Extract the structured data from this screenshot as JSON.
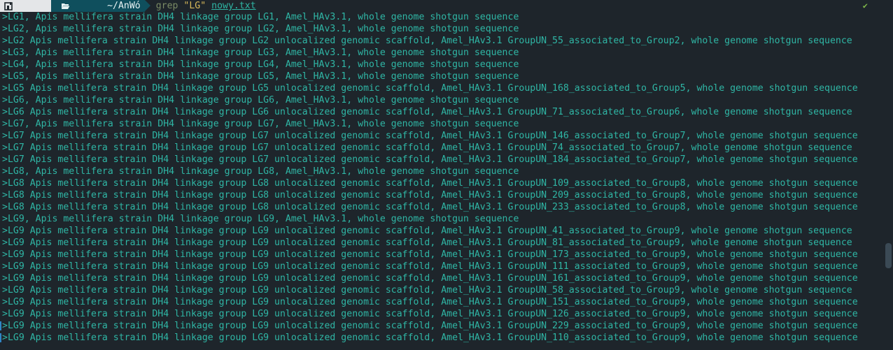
{
  "prompt": {
    "home_icon": "home-icon",
    "folder_icon": "folder-open-icon",
    "directory": "~/AnWó",
    "command": "grep",
    "pattern": "\"LG\"",
    "file": "nowy.txt",
    "status_icon": "checkmark-icon",
    "status_symbol": "✔"
  },
  "colors": {
    "background": "#1e252b",
    "output_text": "#2fb6a5",
    "command_text": "#7a8b65",
    "string_text": "#d6b85a",
    "dir_segment": "#0f4f5d",
    "status_ok": "#7fb84a"
  },
  "output_lines": [
    ">LG1, Apis mellifera strain DH4 linkage group LG1, Amel_HAv3.1, whole genome shotgun sequence",
    ">LG2, Apis mellifera strain DH4 linkage group LG2, Amel_HAv3.1, whole genome shotgun sequence",
    ">LG2 Apis mellifera strain DH4 linkage group LG2 unlocalized genomic scaffold, Amel_HAv3.1 GroupUN_55_associated_to_Group2, whole genome shotgun sequence",
    ">LG3, Apis mellifera strain DH4 linkage group LG3, Amel_HAv3.1, whole genome shotgun sequence",
    ">LG4, Apis mellifera strain DH4 linkage group LG4, Amel_HAv3.1, whole genome shotgun sequence",
    ">LG5, Apis mellifera strain DH4 linkage group LG5, Amel_HAv3.1, whole genome shotgun sequence",
    ">LG5 Apis mellifera strain DH4 linkage group LG5 unlocalized genomic scaffold, Amel_HAv3.1 GroupUN_168_associated_to_Group5, whole genome shotgun sequence",
    ">LG6, Apis mellifera strain DH4 linkage group LG6, Amel_HAv3.1, whole genome shotgun sequence",
    ">LG6 Apis mellifera strain DH4 linkage group LG6 unlocalized genomic scaffold, Amel_HAv3.1 GroupUN_71_associated_to_Group6, whole genome shotgun sequence",
    ">LG7, Apis mellifera strain DH4 linkage group LG7, Amel_HAv3.1, whole genome shotgun sequence",
    ">LG7 Apis mellifera strain DH4 linkage group LG7 unlocalized genomic scaffold, Amel_HAv3.1 GroupUN_146_associated_to_Group7, whole genome shotgun sequence",
    ">LG7 Apis mellifera strain DH4 linkage group LG7 unlocalized genomic scaffold, Amel_HAv3.1 GroupUN_74_associated_to_Group7, whole genome shotgun sequence",
    ">LG7 Apis mellifera strain DH4 linkage group LG7 unlocalized genomic scaffold, Amel_HAv3.1 GroupUN_184_associated_to_Group7, whole genome shotgun sequence",
    ">LG8, Apis mellifera strain DH4 linkage group LG8, Amel_HAv3.1, whole genome shotgun sequence",
    ">LG8 Apis mellifera strain DH4 linkage group LG8 unlocalized genomic scaffold, Amel_HAv3.1 GroupUN_109_associated_to_Group8, whole genome shotgun sequence",
    ">LG8 Apis mellifera strain DH4 linkage group LG8 unlocalized genomic scaffold, Amel_HAv3.1 GroupUN_209_associated_to_Group8, whole genome shotgun sequence",
    ">LG8 Apis mellifera strain DH4 linkage group LG8 unlocalized genomic scaffold, Amel_HAv3.1 GroupUN_233_associated_to_Group8, whole genome shotgun sequence",
    ">LG9, Apis mellifera strain DH4 linkage group LG9, Amel_HAv3.1, whole genome shotgun sequence",
    ">LG9 Apis mellifera strain DH4 linkage group LG9 unlocalized genomic scaffold, Amel_HAv3.1 GroupUN_41_associated_to_Group9, whole genome shotgun sequence",
    ">LG9 Apis mellifera strain DH4 linkage group LG9 unlocalized genomic scaffold, Amel_HAv3.1 GroupUN_81_associated_to_Group9, whole genome shotgun sequence",
    ">LG9 Apis mellifera strain DH4 linkage group LG9 unlocalized genomic scaffold, Amel_HAv3.1 GroupUN_173_associated_to_Group9, whole genome shotgun sequence",
    ">LG9 Apis mellifera strain DH4 linkage group LG9 unlocalized genomic scaffold, Amel_HAv3.1 GroupUN_111_associated_to_Group9, whole genome shotgun sequence",
    ">LG9 Apis mellifera strain DH4 linkage group LG9 unlocalized genomic scaffold, Amel_HAv3.1 GroupUN_161_associated_to_Group9, whole genome shotgun sequence",
    ">LG9 Apis mellifera strain DH4 linkage group LG9 unlocalized genomic scaffold, Amel_HAv3.1 GroupUN_58_associated_to_Group9, whole genome shotgun sequence",
    ">LG9 Apis mellifera strain DH4 linkage group LG9 unlocalized genomic scaffold, Amel_HAv3.1 GroupUN_151_associated_to_Group9, whole genome shotgun sequence",
    ">LG9 Apis mellifera strain DH4 linkage group LG9 unlocalized genomic scaffold, Amel_HAv3.1 GroupUN_126_associated_to_Group9, whole genome shotgun sequence",
    ">LG9 Apis mellifera strain DH4 linkage group LG9 unlocalized genomic scaffold, Amel_HAv3.1 GroupUN_229_associated_to_Group9, whole genome shotgun sequence",
    ">LG9 Apis mellifera strain DH4 linkage group LG9 unlocalized genomic scaffold, Amel_HAv3.1 GroupUN_110_associated_to_Group9, whole genome shotgun sequence"
  ]
}
